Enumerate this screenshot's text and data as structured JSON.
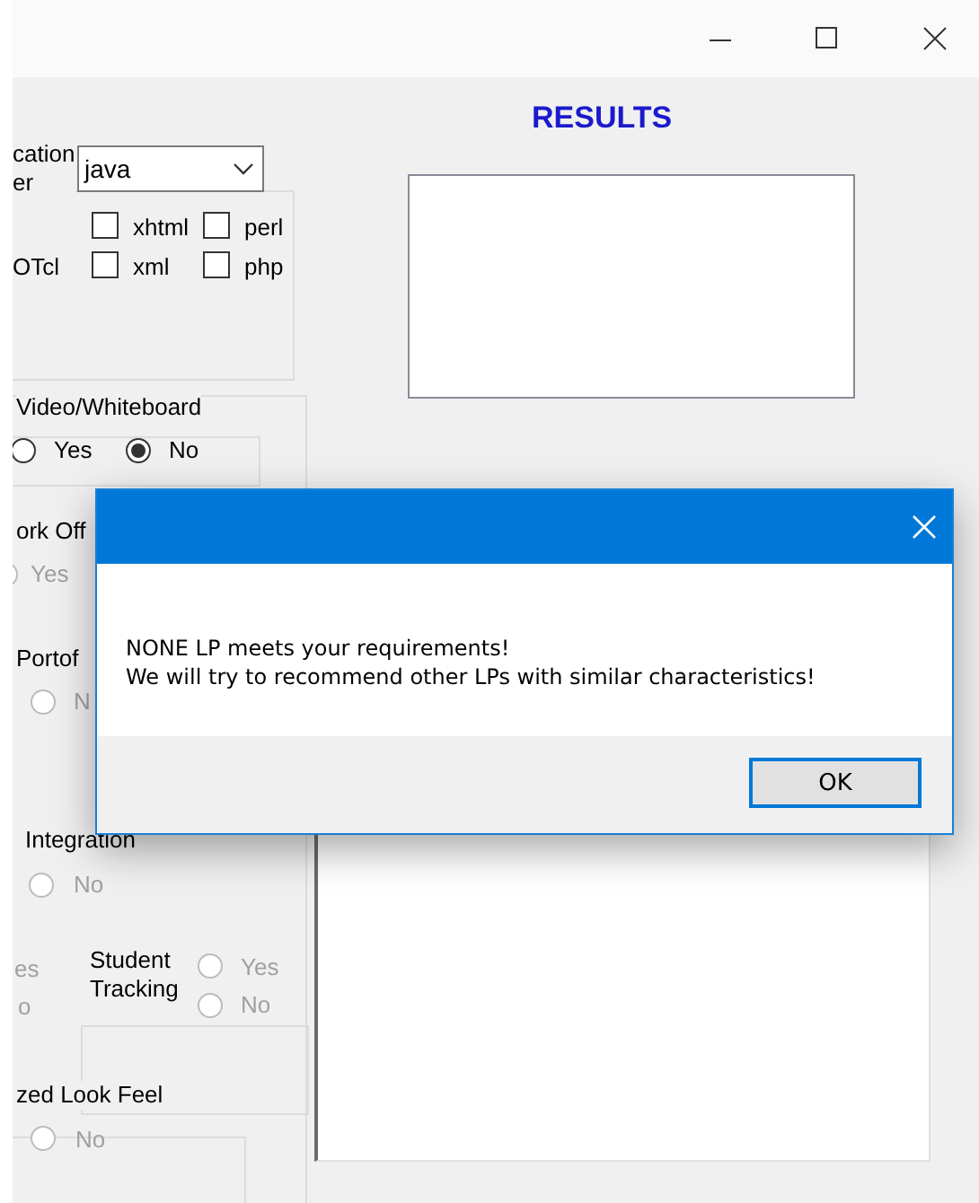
{
  "results": {
    "title": "RESULTS"
  },
  "language": {
    "label": "cation\ner",
    "value": "java"
  },
  "side_label": "OTcl",
  "checkboxes": [
    {
      "label": "xhtml",
      "checked": false
    },
    {
      "label": "perl",
      "checked": false
    },
    {
      "label": "xml",
      "checked": false
    },
    {
      "label": "php",
      "checked": false
    }
  ],
  "radio_groups": [
    {
      "label": "Video/Whiteboard",
      "options": [
        {
          "kind": "radio",
          "label": "Yes",
          "checked": false,
          "disabled": false
        },
        {
          "kind": "radio",
          "label": "No",
          "checked": true,
          "disabled": false
        }
      ]
    },
    {
      "label": "ork Off",
      "options": [
        {
          "kind": "radio",
          "label": "Yes",
          "checked": false,
          "disabled": true
        }
      ]
    },
    {
      "label": "Portof",
      "options": [
        {
          "kind": "radio",
          "label": "N",
          "checked": false,
          "disabled": true
        }
      ]
    },
    {
      "label": "Integration",
      "options": [
        {
          "kind": "radio",
          "label": "No",
          "checked": false,
          "disabled": true
        }
      ]
    },
    {
      "options": [
        {
          "kind": "text",
          "label": "es",
          "disabled": true
        },
        {
          "kind": "text",
          "label": "o",
          "disabled": true
        }
      ]
    },
    {
      "label": "Student\nTracking",
      "options": [
        {
          "kind": "radio",
          "label": "Yes",
          "checked": false,
          "disabled": true
        },
        {
          "kind": "radio",
          "label": "No",
          "checked": false,
          "disabled": true
        }
      ]
    },
    {
      "label": "zed Look Feel",
      "options": [
        {
          "kind": "radio",
          "label": "No",
          "checked": false,
          "disabled": true
        }
      ]
    }
  ],
  "dialog": {
    "message": "NONE LP meets your requirements!\nWe will try to recommend other LPs with similar characteristics!",
    "button": "OK"
  }
}
